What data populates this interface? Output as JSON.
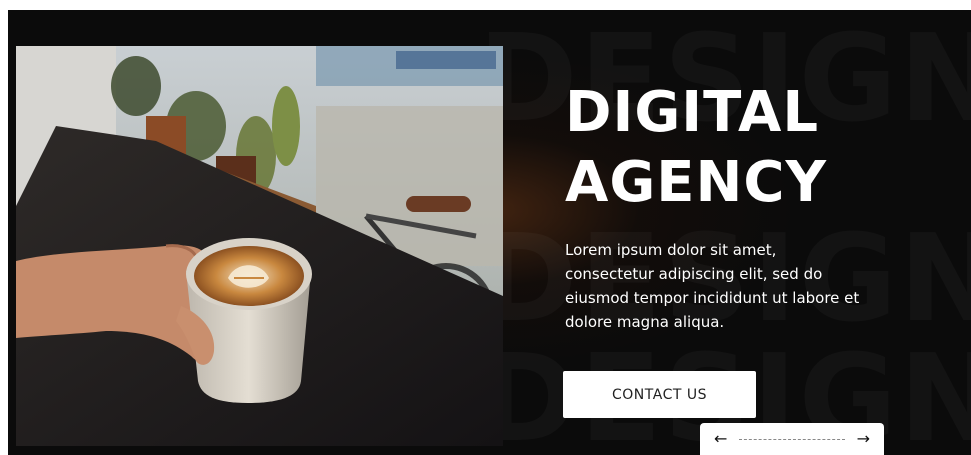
{
  "hero": {
    "heading_line1": "DIGITAL",
    "heading_line2": "AGENCY",
    "body": "Lorem ipsum dolor sit amet, consectetur adipiscing elit, sed do eiusmod tempor incididunt ut labore et dolore magna aliqua.",
    "cta_label": "CONTACT US",
    "watermark_word": "DESIGN"
  },
  "slider": {
    "prev_icon": "arrow-left-icon",
    "next_icon": "arrow-right-icon"
  },
  "colors": {
    "background": "#0b0b0b",
    "accent_glow": "#6e3714",
    "text": "#ffffff",
    "button_bg": "#ffffff",
    "button_text": "#222222"
  }
}
